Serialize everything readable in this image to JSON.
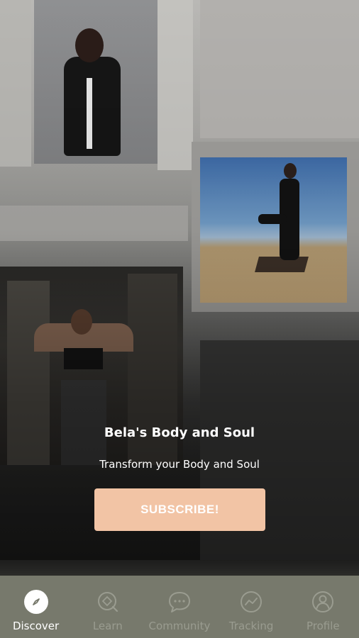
{
  "hero": {
    "title": "Bela's Body and Soul",
    "subtitle": "Transform your Body and Soul",
    "subscribe_label": "SUBSCRIBE!"
  },
  "colors": {
    "accent_button": "#f2c4a5",
    "tabbar_bg": "#77796c",
    "tab_inactive": "#9a9c90",
    "tab_active": "#ffffff"
  },
  "tabs": [
    {
      "label": "Discover",
      "icon": "compass-icon",
      "active": true
    },
    {
      "label": "Learn",
      "icon": "learn-icon",
      "active": false
    },
    {
      "label": "Community",
      "icon": "chat-bubble-icon",
      "active": false
    },
    {
      "label": "Tracking",
      "icon": "tracking-chart-icon",
      "active": false
    },
    {
      "label": "Profile",
      "icon": "profile-icon",
      "active": false
    }
  ]
}
